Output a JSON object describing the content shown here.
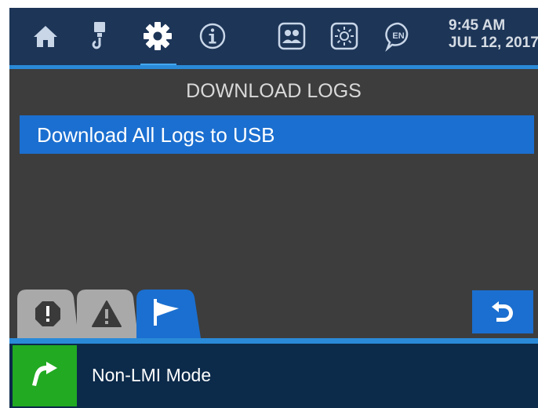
{
  "header": {
    "nav_icons": [
      "home-icon",
      "crane-hook-icon",
      "settings-gear-icon",
      "info-icon",
      "operator-icon",
      "brightness-icon",
      "language-icon"
    ],
    "active_nav": "settings-gear-icon",
    "language_badge": "EN",
    "time": "9:45 AM",
    "date": "JUL 12, 2017"
  },
  "main": {
    "title": "DOWNLOAD LOGS",
    "items": [
      {
        "label": "Download All Logs to USB",
        "selected": true
      }
    ]
  },
  "tabs": [
    {
      "icon": "error-octagon-icon",
      "active": false
    },
    {
      "icon": "warning-triangle-icon",
      "active": false
    },
    {
      "icon": "flag-icon",
      "active": true
    }
  ],
  "back_button": {
    "icon": "back-arrow-icon"
  },
  "footer": {
    "mode_icon": "return-arrow-icon",
    "mode_label": "Non-LMI Mode"
  },
  "colors": {
    "header_bg": "#1d3557",
    "accent": "#2a8ad8",
    "selection": "#1b6fd0",
    "panel": "#3d3d3d",
    "footer_bg": "#0c2a4a",
    "mode_button": "#22aa22",
    "inactive_tab": "#a9a9a9"
  }
}
